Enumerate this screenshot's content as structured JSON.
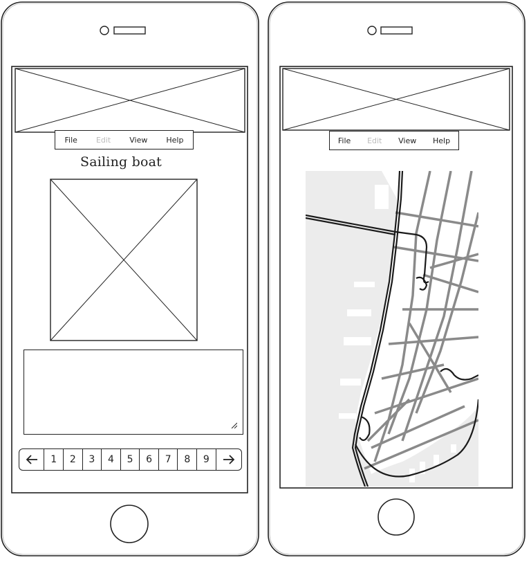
{
  "colors": {
    "stroke": "#222222",
    "map_water": "#ececec",
    "map_road": "#8a8a8a",
    "map_highway": "#1a1a1a",
    "disabled_text": "#bbbbbb"
  },
  "left_screen": {
    "menu": {
      "items": [
        {
          "label": "File",
          "enabled": true
        },
        {
          "label": "Edit",
          "enabled": false
        },
        {
          "label": "View",
          "enabled": true
        },
        {
          "label": "Help",
          "enabled": true
        }
      ]
    },
    "title": "Sailing boat",
    "pagination": {
      "prev_icon": "arrow-left-icon",
      "next_icon": "arrow-right-icon",
      "pages": [
        "1",
        "2",
        "3",
        "4",
        "5",
        "6",
        "7",
        "8",
        "9"
      ]
    }
  },
  "right_screen": {
    "menu": {
      "items": [
        {
          "label": "File",
          "enabled": true
        },
        {
          "label": "Edit",
          "enabled": false
        },
        {
          "label": "View",
          "enabled": true
        },
        {
          "label": "Help",
          "enabled": true
        }
      ]
    },
    "map_icon": "map-view"
  }
}
